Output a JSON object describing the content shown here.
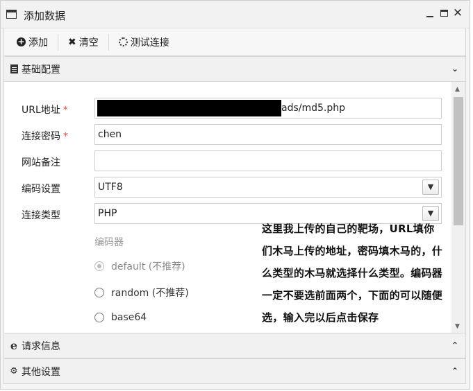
{
  "window": {
    "title": "添加数据"
  },
  "toolbar": {
    "add_label": "添加",
    "clear_label": "清空",
    "test_label": "测试连接"
  },
  "sections": {
    "basic": {
      "label": "基础配置",
      "expanded": true
    },
    "request": {
      "label": "请求信息",
      "expanded": false
    },
    "other": {
      "label": "其他设置",
      "expanded": false
    }
  },
  "form": {
    "url": {
      "label": "URL地址",
      "required_mark": "*",
      "value_visible_tail": "ads/md5.php",
      "redacted": true
    },
    "password": {
      "label": "连接密码",
      "required_mark": "*",
      "value": "chen"
    },
    "note": {
      "label": "网站备注",
      "value": ""
    },
    "encoding": {
      "label": "编码设置",
      "value": "UTF8"
    },
    "type": {
      "label": "连接类型",
      "value": "PHP"
    },
    "encoder": {
      "title": "编码器",
      "options": [
        {
          "label": "default (不推荐)",
          "checked": true,
          "disabled": true
        },
        {
          "label": "random (不推荐)",
          "checked": false,
          "disabled": false
        },
        {
          "label": "base64",
          "checked": false,
          "disabled": false
        }
      ]
    }
  },
  "annotation": {
    "text": "这里我上传的自己的靶场，URL填你们木马上传的地址，密码填木马的，什么类型的木马就选择什么类型。编码器一定不要选前面两个，下面的可以随便选，输入完以后点击保存"
  },
  "icons": {
    "title": "window-icon",
    "add": "plus-circle-icon",
    "clear": "x-icon",
    "test": "spinner-icon",
    "basic": "document-icon",
    "request": "e-icon",
    "other": "gears-icon"
  }
}
